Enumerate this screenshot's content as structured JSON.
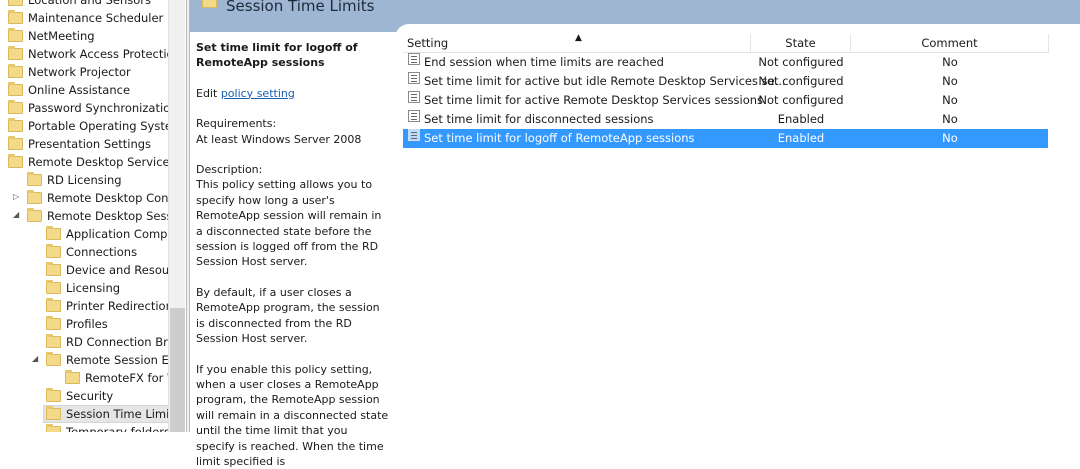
{
  "tree": [
    {
      "label": "Location and Sensors",
      "level": 0
    },
    {
      "label": "Maintenance Scheduler",
      "level": 0
    },
    {
      "label": "NetMeeting",
      "level": 0
    },
    {
      "label": "Network Access Protection",
      "level": 0
    },
    {
      "label": "Network Projector",
      "level": 0
    },
    {
      "label": "Online Assistance",
      "level": 0
    },
    {
      "label": "Password Synchronization",
      "level": 0
    },
    {
      "label": "Portable Operating System",
      "level": 0
    },
    {
      "label": "Presentation Settings",
      "level": 0
    },
    {
      "label": "Remote Desktop Services",
      "level": 0
    },
    {
      "label": "RD Licensing",
      "level": 1
    },
    {
      "label": "Remote Desktop Connection Client",
      "level": 1,
      "expander": "collapsed"
    },
    {
      "label": "Remote Desktop Session Host",
      "level": 1,
      "expander": "expanded"
    },
    {
      "label": "Application Compatibility",
      "level": 2
    },
    {
      "label": "Connections",
      "level": 2
    },
    {
      "label": "Device and Resource Redirection",
      "level": 2
    },
    {
      "label": "Licensing",
      "level": 2
    },
    {
      "label": "Printer Redirection",
      "level": 2
    },
    {
      "label": "Profiles",
      "level": 2
    },
    {
      "label": "RD Connection Broker",
      "level": 2
    },
    {
      "label": "Remote Session Environment",
      "level": 2,
      "expander": "expanded"
    },
    {
      "label": "RemoteFX for Windows Server",
      "level": 3
    },
    {
      "label": "Security",
      "level": 2
    },
    {
      "label": "Session Time Limits",
      "level": 2,
      "selected": true
    },
    {
      "label": "Temporary folders",
      "level": 2
    }
  ],
  "header": {
    "title": "Session Time Limits"
  },
  "details": {
    "title": "Set time limit for logoff of RemoteApp sessions",
    "edit_prefix": "Edit ",
    "edit_link": "policy setting",
    "requirements_label": "Requirements:",
    "requirements": "At least Windows Server 2008",
    "description_label": "Description:",
    "paragraphs": [
      "This policy setting allows you to specify how long a user's RemoteApp session will remain in a disconnected state before the session is logged off from the RD Session Host server.",
      "By default, if a user closes a RemoteApp program, the session is disconnected from the RD Session Host server.",
      "If you enable this policy setting, when a user closes a RemoteApp program, the RemoteApp session will remain in a disconnected state until the time limit that you specify is reached. When the time limit specified is"
    ]
  },
  "list": {
    "columns": [
      "Setting",
      "State",
      "Comment"
    ],
    "sort_indicator": "▲",
    "rows": [
      {
        "setting": "End session when time limits are reached",
        "state": "Not configured",
        "comment": "No"
      },
      {
        "setting": "Set time limit for active but idle Remote Desktop Services se...",
        "state": "Not configured",
        "comment": "No"
      },
      {
        "setting": "Set time limit for active Remote Desktop Services sessions",
        "state": "Not configured",
        "comment": "No"
      },
      {
        "setting": "Set time limit for disconnected sessions",
        "state": "Enabled",
        "comment": "No"
      },
      {
        "setting": "Set time limit for logoff of RemoteApp sessions",
        "state": "Enabled",
        "comment": "No",
        "selected": true
      }
    ]
  }
}
